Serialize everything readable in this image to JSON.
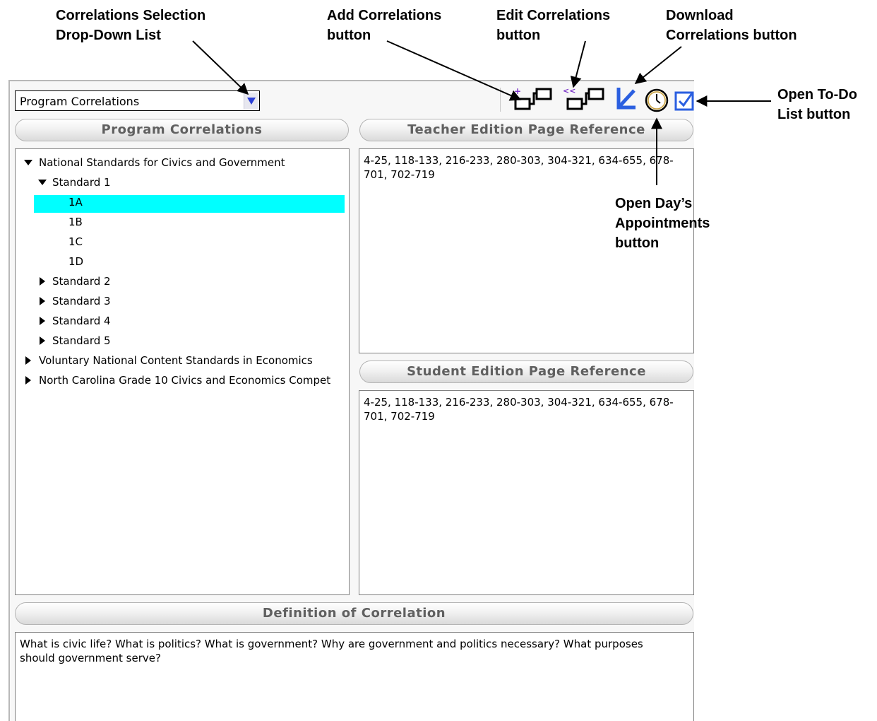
{
  "callouts": {
    "dropdown": "Correlations Selection\nDrop-Down List",
    "add": "Add Correlations\nbutton",
    "edit": "Edit Correlations\nbutton",
    "download": "Download\nCorrelations button",
    "todo": "Open To-Do\nList button",
    "appointments": "Open Day’s\nAppointments\nbutton"
  },
  "toolbar": {
    "select_value": "Program Correlations",
    "icons": [
      "add-correlations-icon",
      "edit-correlations-icon",
      "download-correlations-icon",
      "clock-icon",
      "todo-checkbox-icon"
    ]
  },
  "headers": {
    "program": "Program Correlations",
    "teacher": "Teacher Edition Page Reference",
    "student": "Student Edition Page Reference",
    "definition": "Definition of Correlation"
  },
  "tree": [
    {
      "label": "National Standards for Civics and Government",
      "expanded": true,
      "level": 0
    },
    {
      "label": "Standard 1",
      "expanded": true,
      "level": 1
    },
    {
      "label": "1A",
      "selected": true,
      "level": 2
    },
    {
      "label": "1B",
      "level": 2
    },
    {
      "label": "1C",
      "level": 2
    },
    {
      "label": "1D",
      "level": 2
    },
    {
      "label": "Standard 2",
      "expanded": false,
      "level": 1
    },
    {
      "label": "Standard 3",
      "expanded": false,
      "level": 1
    },
    {
      "label": "Standard 4",
      "expanded": false,
      "level": 1
    },
    {
      "label": "Standard 5",
      "expanded": false,
      "level": 1
    },
    {
      "label": "Voluntary National Content Standards in Economics",
      "expanded": false,
      "level": 0
    },
    {
      "label": "North Carolina Grade 10 Civics and Economics Compet",
      "expanded": false,
      "level": 0
    }
  ],
  "teacher_ref": "4-25, 118-133, 216-233, 280-303, 304-321, 634-655, 678-701, 702-719",
  "student_ref": "4-25, 118-133, 216-233, 280-303, 304-321, 634-655, 678-701, 702-719",
  "definition_text": "What is civic life? What is politics? What is government? Why are government and politics necessary? What purposes should government serve?",
  "colors": {
    "selection": "#00ffff",
    "dropdown_arrow": "#2b3fd6",
    "icon_blue": "#2b5fe0",
    "icon_purple": "#7b34c8"
  }
}
